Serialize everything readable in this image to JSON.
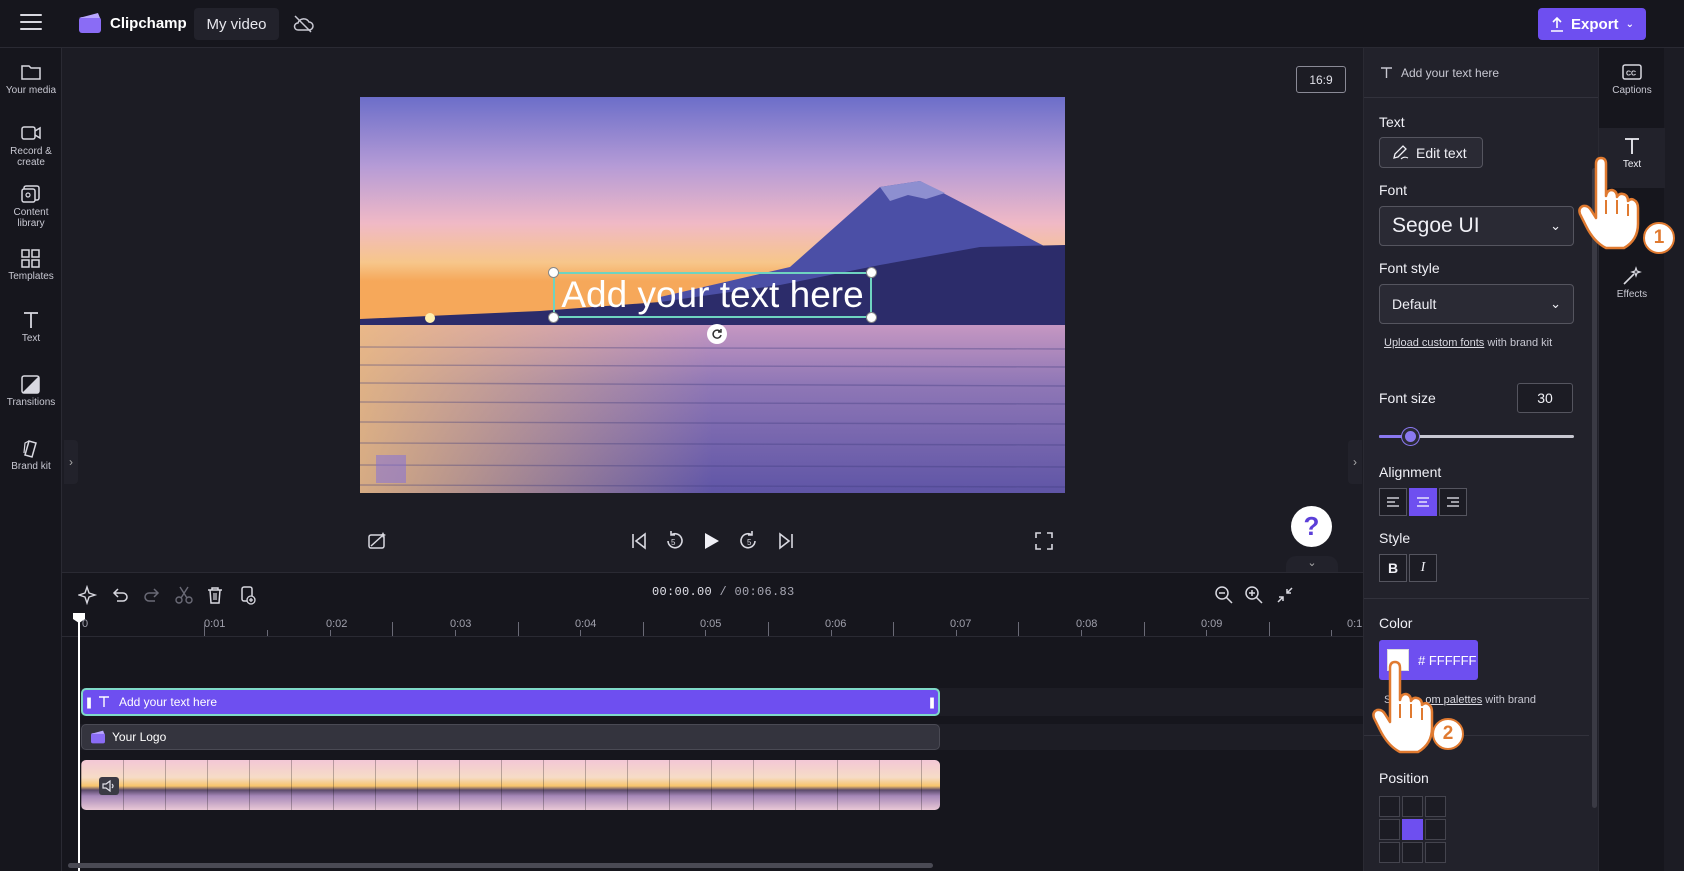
{
  "topbar": {
    "brand": "Clipchamp",
    "project_title": "My video",
    "export_label": "Export"
  },
  "sidebar": {
    "items": [
      {
        "label": "Your media",
        "icon": "folder-icon"
      },
      {
        "label": "Record & create",
        "icon": "camera-icon"
      },
      {
        "label": "Content library",
        "icon": "library-icon"
      },
      {
        "label": "Templates",
        "icon": "templates-icon"
      },
      {
        "label": "Text",
        "icon": "text-icon"
      },
      {
        "label": "Transitions",
        "icon": "transitions-icon"
      },
      {
        "label": "Brand kit",
        "icon": "brand-kit-icon"
      }
    ]
  },
  "preview": {
    "aspect_ratio": "16:9",
    "overlay_text": "Add your text here"
  },
  "timeline": {
    "current_time": "00:00.00",
    "total_time": "/ 00:06.83",
    "ruler_labels": [
      "0",
      "0:01",
      "0:02",
      "0:03",
      "0:04",
      "0:05",
      "0:06",
      "0:07",
      "0:08",
      "0:09",
      "0:1"
    ],
    "tracks": {
      "text_clip": "Add your text here",
      "logo_clip": "Your Logo"
    }
  },
  "panel": {
    "header": "Add your text here",
    "text_section": "Text",
    "edit_text": "Edit text",
    "font_section": "Font",
    "font_value": "Segoe UI",
    "font_style_section": "Font style",
    "font_style_value": "Default",
    "upload_link": "Upload custom fonts",
    "upload_rest": " with brand kit",
    "font_size_section": "Font size",
    "font_size_value": "30",
    "font_size_fraction": 0.16,
    "alignment_section": "Alignment",
    "style_section": "Style",
    "bold": "B",
    "italic": "I",
    "color_section": "Color",
    "color_value": "# FFFFFF",
    "palettes_link": "om palettes",
    "palettes_rest": " with brand",
    "palettes_prefix": "S",
    "position_section": "Position"
  },
  "right_tabs": [
    {
      "label": "Captions",
      "icon": "captions-icon"
    },
    {
      "label": "Text",
      "icon": "text-icon"
    },
    {
      "label": "Effects",
      "icon": "effects-icon"
    }
  ],
  "pointers": {
    "step_one": "1",
    "step_two": "2"
  },
  "colors": {
    "accent": "#6e4ff0",
    "selection": "#6fd3c0",
    "text_color": "#FFFFFF"
  },
  "help_label": "?"
}
